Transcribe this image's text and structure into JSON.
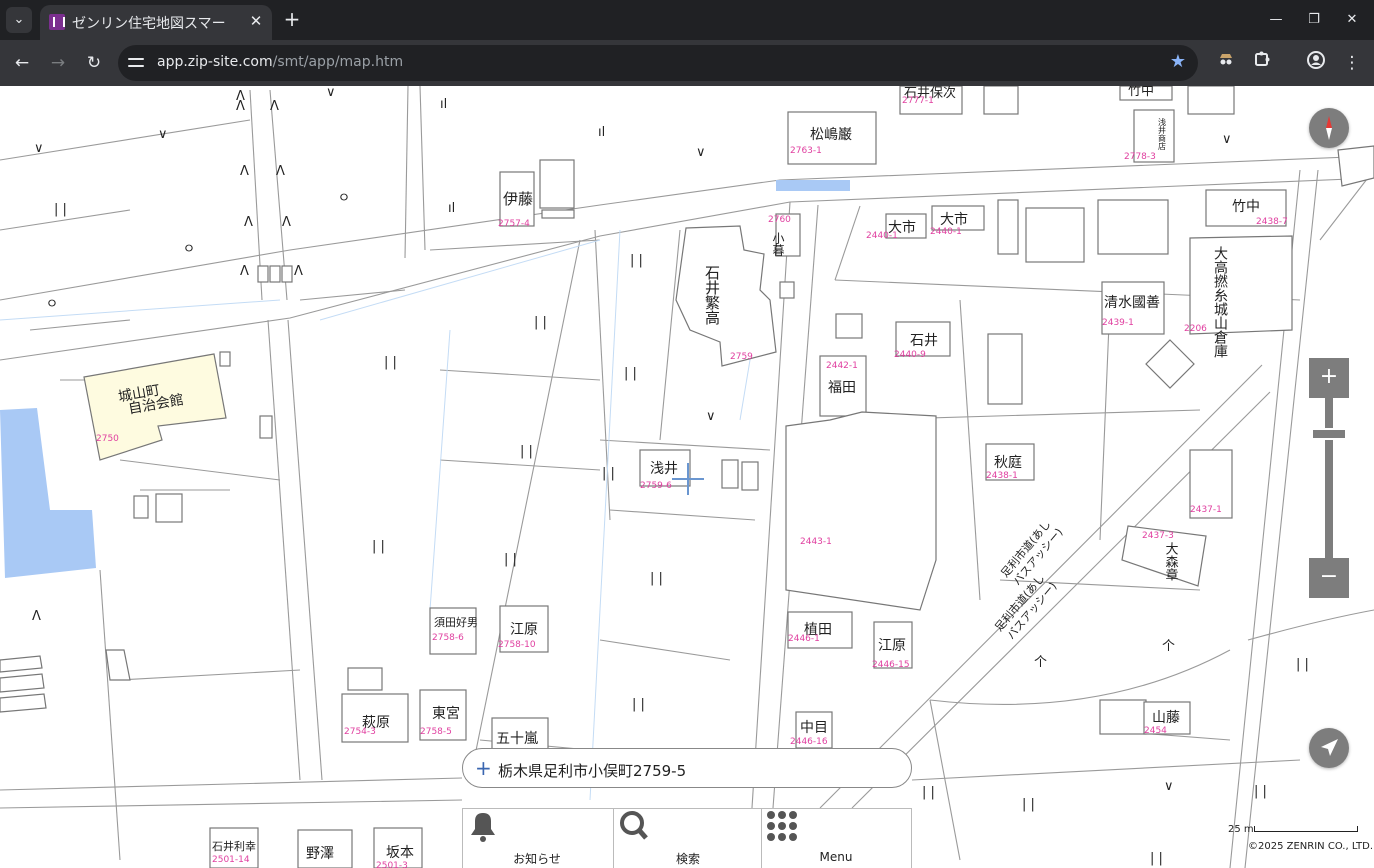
{
  "browser": {
    "tab_title": "ゼンリン住宅地図スマー",
    "url_host": "app.zip-site.com",
    "url_path": "/smt/app/map.htm"
  },
  "map": {
    "map_labels": {
      "matsushima": "松嶋巌",
      "ishii_hoji": "石井保次",
      "take": "竹中",
      "ishii_parcel": "2777-1",
      "parcel_2763": "2763-1",
      "parcel_2778": "2778-3",
      "shop_vertical": "浅井商店",
      "ito": "伊藤",
      "parcel_2757": "2757-4",
      "ko_gure": "小暮",
      "parcel_2760": "2760",
      "oichi1": "大市",
      "oichi1_parcel": "2440-1",
      "oichi2": "大市",
      "oichi2_parcel": "2440-1",
      "takenaka": "竹中",
      "takenaka_parcel": "2438-7",
      "ishii_shigetaka": "石井繁高",
      "parcel_2759": "2759",
      "otaka": "大高撚糸城山倉庫",
      "parcel_2206": "2206",
      "shimizu": "清水國善",
      "parcel_2439": "2439-1",
      "ishii2": "石井",
      "parcel_2440_9": "2440-9",
      "fukuda": "福田",
      "parcel_2442": "2442-1",
      "shiroyama_1": "城山町",
      "shiroyama_2": "自治会館",
      "parcel_2750": "2750",
      "asai": "浅井",
      "parcel_2759_6": "2759-6",
      "akiba": "秋庭",
      "parcel_2438": "2438-1",
      "parcel_2437": "2437-1",
      "parcel_2443": "2443-1",
      "omori": "大森章",
      "parcel_2437_3": "2437-3",
      "road_1": "足利市道(あし",
      "road_1b": "バスアッシー)",
      "road_2": "足利市道(あし",
      "road_2b": "バスアッシー)",
      "sudakou": "須田好男",
      "parcel_2758_6": "2758-6",
      "ebara": "江原",
      "parcel_2758_10": "2758-10",
      "ueda": "植田",
      "parcel_2446_1": "2446-1",
      "ebara2": "江原",
      "parcel_2446_15": "2446-15",
      "hagiwara": "萩原",
      "parcel_2754": "2754-3",
      "higashimiya": "東宮",
      "parcel_2758_5": "2758-5",
      "igarashi": "五十嵐",
      "nakame": "中目",
      "parcel_2446_16": "2446-16",
      "yamafuji": "山藤",
      "parcel_2454": "2454",
      "ishii_toshiyuki": "石井利幸",
      "parcel_2501": "2501-14",
      "nozawa": "野澤",
      "sakamoto": "坂本",
      "parcel_2501_3": "2501-3"
    },
    "address": "栃木県足利市小俣町2759-5",
    "bottom_nav": {
      "notice": "お知らせ",
      "search": "検索",
      "menu": "Menu"
    },
    "scale_label": "25 m",
    "copyright": "©2025 ZENRIN CO., LTD."
  },
  "colors": {
    "water": "#a9c9f5",
    "building_highlight": "#fefbe0",
    "parcel_text": "#e040a0",
    "control_gray": "#7d7d7d"
  }
}
